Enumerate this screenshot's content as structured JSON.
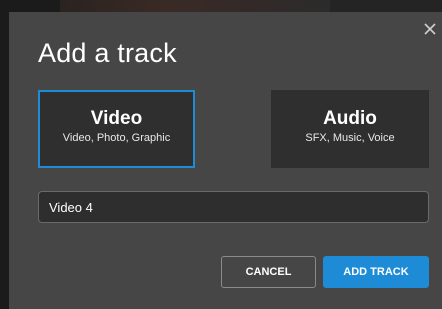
{
  "dialog": {
    "title": "Add a track",
    "close_icon": "close-icon"
  },
  "track_types": [
    {
      "label": "Video",
      "description": "Video, Photo, Graphic",
      "selected": true
    },
    {
      "label": "Audio",
      "description": "SFX, Music, Voice",
      "selected": false
    }
  ],
  "track_name": {
    "value": "Video 4",
    "placeholder": ""
  },
  "buttons": {
    "cancel_label": "CANCEL",
    "add_label": "ADD TRACK"
  },
  "colors": {
    "accent": "#1e8bd6",
    "dialog_bg": "#464646",
    "card_bg": "#2f2f2f"
  }
}
